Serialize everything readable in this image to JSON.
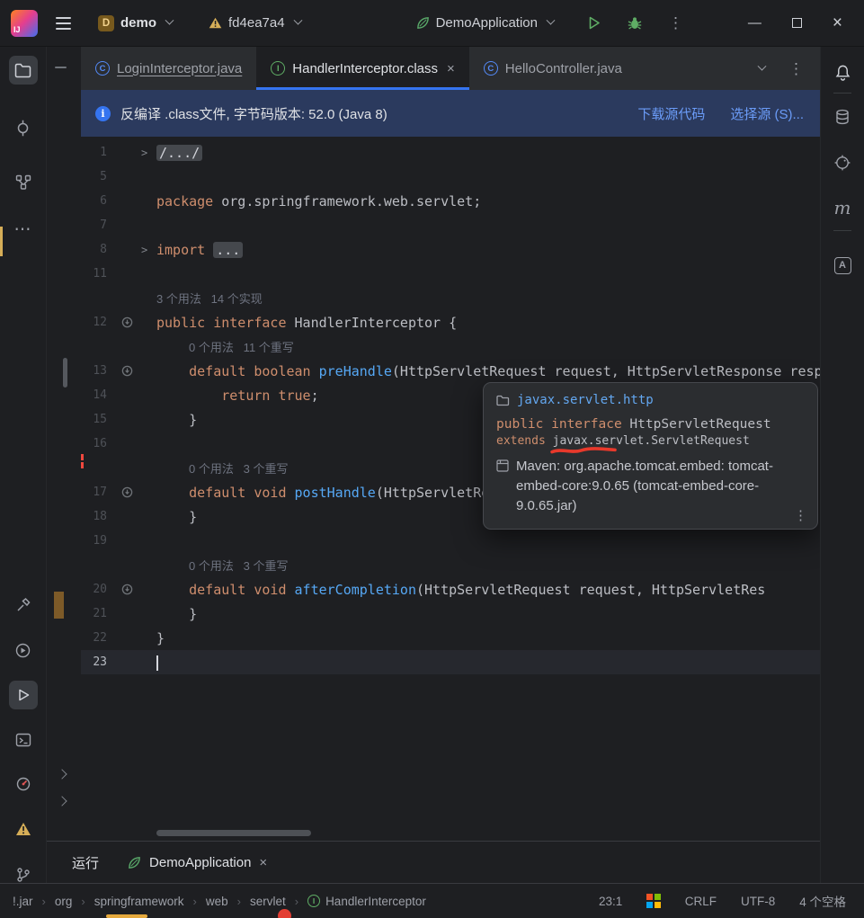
{
  "icons": {
    "logo_text": "IJ",
    "class_letter": "C",
    "interface_letter": "I",
    "maven_letter": "m",
    "assistant_letter": "A",
    "info_letter": "i",
    "fold_glyph": ">",
    "close_glyph": "×",
    "minimize_glyph": "—",
    "more_vertical_glyph": "⋮",
    "more_horizontal_glyph": "⋯"
  },
  "title_bar": {
    "project": {
      "badge": "D",
      "name": "demo"
    },
    "branch": "fd4ea7a4",
    "run_config": "DemoApplication"
  },
  "tab_bar": {
    "tabs": [
      {
        "label": "LoginInterceptor.java",
        "kind": "class",
        "selected": false,
        "underlined": true,
        "closable": false
      },
      {
        "label": "HandlerInterceptor.class",
        "kind": "interface",
        "selected": true,
        "underlined": false,
        "closable": true
      },
      {
        "label": "HelloController.java",
        "kind": "class",
        "selected": false,
        "underlined": false,
        "closable": false
      }
    ]
  },
  "banner": {
    "message": "反编译 .class文件, 字节码版本: 52.0 (Java 8)",
    "link_download": "下载源代码",
    "link_choose": "选择源 (S)..."
  },
  "editor": {
    "lines": [
      {
        "num": "1",
        "fold": true,
        "tokens": [
          {
            "t": "/.../",
            "c": "chip"
          }
        ]
      },
      {
        "num": "5",
        "tokens": []
      },
      {
        "num": "6",
        "tokens": [
          {
            "t": "package ",
            "c": "kw"
          },
          {
            "t": "org.springframework.web.servlet;",
            "c": "pl"
          }
        ]
      },
      {
        "num": "7",
        "tokens": []
      },
      {
        "num": "8",
        "fold": true,
        "tokens": [
          {
            "t": "import ",
            "c": "kw"
          },
          {
            "t": "...",
            "c": "chip"
          }
        ]
      },
      {
        "num": "11",
        "tokens": []
      },
      {
        "hint": "3 个用法   14 个实现",
        "indent": 0
      },
      {
        "num": "12",
        "icon": "implemented-interface",
        "tokens": [
          {
            "t": "public interface ",
            "c": "kw"
          },
          {
            "t": "HandlerInterceptor {",
            "c": "pl"
          }
        ]
      },
      {
        "hint": "0 个用法   11 个重写",
        "indent": 1
      },
      {
        "num": "13",
        "icon": "overridden-method",
        "tokens": [
          {
            "t": "    ",
            "c": "pl"
          },
          {
            "t": "default boolean ",
            "c": "kw"
          },
          {
            "t": "preHandle",
            "c": "fn"
          },
          {
            "t": "(HttpServletRequest request, HttpServletResponse resp",
            "c": "pl"
          }
        ]
      },
      {
        "num": "14",
        "tokens": [
          {
            "t": "        ",
            "c": "pl"
          },
          {
            "t": "return true",
            "c": "kw"
          },
          {
            "t": ";",
            "c": "pl"
          }
        ]
      },
      {
        "num": "15",
        "tokens": [
          {
            "t": "    }",
            "c": "pl"
          }
        ]
      },
      {
        "num": "16",
        "tokens": []
      },
      {
        "hint": "0 个用法   3 个重写",
        "indent": 1
      },
      {
        "num": "17",
        "icon": "overridden-method",
        "tokens": [
          {
            "t": "    ",
            "c": "pl"
          },
          {
            "t": "default void ",
            "c": "kw"
          },
          {
            "t": "postHandle",
            "c": "fn"
          },
          {
            "t": "(HttpServletRequest request, HttpServletResponse resp",
            "c": "pl"
          }
        ]
      },
      {
        "num": "18",
        "tokens": [
          {
            "t": "    }",
            "c": "pl"
          }
        ]
      },
      {
        "num": "19",
        "tokens": []
      },
      {
        "hint": "0 个用法   3 个重写",
        "indent": 1
      },
      {
        "num": "20",
        "icon": "overridden-method",
        "tokens": [
          {
            "t": "    ",
            "c": "pl"
          },
          {
            "t": "default void ",
            "c": "kw"
          },
          {
            "t": "afterCompletion",
            "c": "fn"
          },
          {
            "t": "(HttpServletRequest request, HttpServletRes",
            "c": "pl"
          }
        ]
      },
      {
        "num": "21",
        "tokens": [
          {
            "t": "    }",
            "c": "pl"
          }
        ]
      },
      {
        "num": "22",
        "tokens": [
          {
            "t": "}",
            "c": "pl"
          }
        ]
      },
      {
        "num": "23",
        "current": true,
        "tokens": []
      }
    ]
  },
  "doc_popup": {
    "package": "javax.servlet.http",
    "decl_keyword": "public interface",
    "decl_name": " HttpServletRequest",
    "extends_keyword": "extends ",
    "extends_type": "javax.servlet.ServletRequest",
    "maven_info": "Maven: org.apache.tomcat.embed: tomcat-embed-core:9.0.65 (tomcat-embed-core-9.0.65.jar)"
  },
  "run_panel": {
    "title": "运行",
    "tab_label": "DemoApplication"
  },
  "status_bar": {
    "breadcrumbs": [
      {
        "label": "!.jar"
      },
      {
        "label": "org"
      },
      {
        "label": "springframework"
      },
      {
        "label": "web"
      },
      {
        "label": "servlet"
      },
      {
        "label": "HandlerInterceptor",
        "icon": "interface"
      }
    ],
    "caret": "23:1",
    "line_sep": "CRLF",
    "encoding": "UTF-8",
    "indent": "4 个空格"
  },
  "colors": {
    "accent": "#3574f0",
    "keyword": "#cf8e6d",
    "method": "#56a8f5",
    "editor_text": "#bcbec4",
    "link": "#6b9cf8",
    "warning": "#d6ae58",
    "run_green": "#5fad65",
    "class_blue": "#548af7",
    "interface_green": "#5fad65",
    "annotation_red": "#e8392b"
  }
}
